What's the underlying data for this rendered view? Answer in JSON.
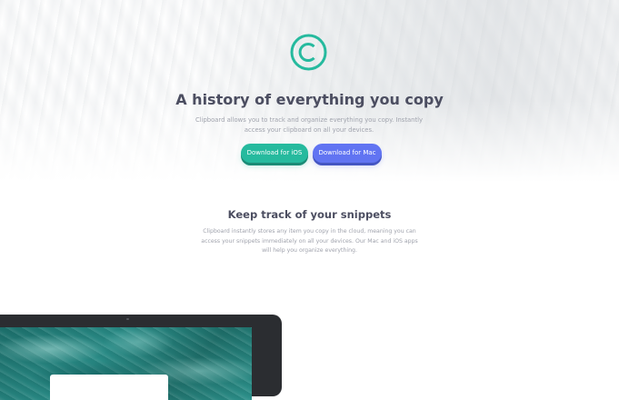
{
  "hero": {
    "title": "A history of everything you copy",
    "description": "Clipboard allows you to track and organize everything you copy. Instantly access your clipboard on all your devices.",
    "download_ios_label": "Download for iOS",
    "download_mac_label": "Download for Mac",
    "logo_icon": "copyright-circle-icon"
  },
  "snippets": {
    "title": "Keep track of your snippets",
    "description": "Clipboard instantly stores any item you copy in the cloud, meaning you can access your snippets immediately on all your devices. Our Mac and iOS apps will help you organize everything."
  },
  "colors": {
    "accent_green": "#26ba9e",
    "accent_blue": "#6174f2",
    "heading_text": "#4c4e61",
    "body_text": "#a0a3ad"
  }
}
